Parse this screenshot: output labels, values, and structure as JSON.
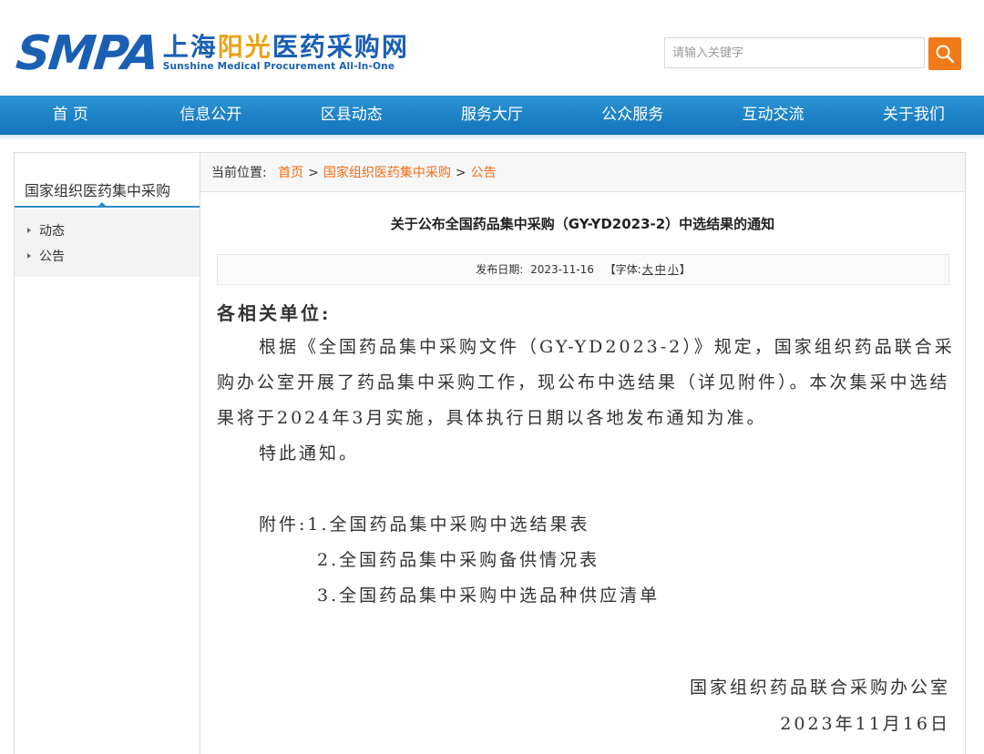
{
  "brand": {
    "mark": "SMPA",
    "name_plain": "上海",
    "name_accent": "阳光",
    "name_rest": "医药采购网",
    "tagline": "Sunshine Medical Procurement All-In-One"
  },
  "search": {
    "placeholder": "请输入关键字",
    "icon": "search-icon"
  },
  "nav": [
    "首 页",
    "信息公开",
    "区县动态",
    "服务大厅",
    "公众服务",
    "互动交流",
    "关于我们"
  ],
  "sidebar": {
    "title": "国家组织医药集中采购",
    "items": [
      "动态",
      "公告"
    ]
  },
  "breadcrumb": {
    "prefix": "当前位置:",
    "items": [
      "首页",
      "国家组织医药集中采购",
      "公告"
    ],
    "separator": ">"
  },
  "article": {
    "title": "关于公布全国药品集中采购（GY-YD2023-2）中选结果的通知",
    "date_label": "发布日期:",
    "date": "2023-11-16",
    "font_label": "【字体:",
    "font_sizes": [
      "大",
      "中",
      "小"
    ],
    "font_close": "】",
    "salutation": "各相关单位:",
    "paragraphs": [
      "根据《全国药品集中采购文件（GY-YD2023-2）》规定，国家组织药品联合采购办公室开展了药品集中采购工作，现公布中选结果（详见附件）。本次集采中选结果将于2024年3月实施，具体执行日期以各地发布通知为准。",
      "特此通知。"
    ],
    "attachments_label": "附件:",
    "attachments": [
      "1.全国药品集中采购中选结果表",
      "2.全国药品集中采购备供情况表",
      "3.全国药品集中采购中选品种供应清单"
    ],
    "signature": "国家组织药品联合采购办公室",
    "sign_date": "2023年11月16日"
  },
  "colors": {
    "brand_blue": "#1a5fb4",
    "accent_orange": "#f07a1a",
    "nav_blue": "#1a84c8",
    "link_orange": "#f06c14"
  }
}
